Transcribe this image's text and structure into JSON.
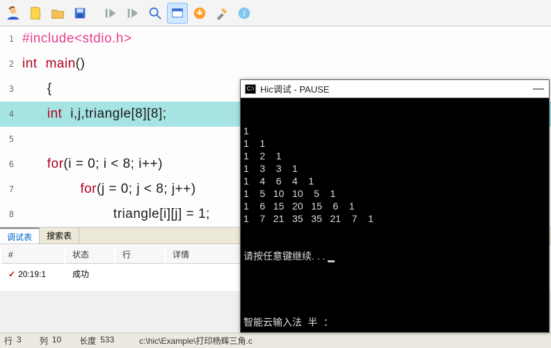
{
  "toolbar": {
    "icons": [
      "avatar",
      "note",
      "folder",
      "save",
      "sep",
      "run",
      "step",
      "search",
      "window",
      "download",
      "tools",
      "info"
    ]
  },
  "code": {
    "lines": [
      {
        "n": "1",
        "html": "<span class='k-pp'>#include&lt;stdio.h&gt;</span>"
      },
      {
        "n": "2",
        "html": "<span class='k-type'>int</span> <span class='k-type'>main</span><span class='k-id'>()</span>"
      },
      {
        "n": "3",
        "html": "   <span class='k-id'>{</span>"
      },
      {
        "n": "4",
        "html": "   <span class='k-type'>int</span> <span class='k-id'>i,j,triangle[8][8];</span>",
        "hl": true
      },
      {
        "n": "5",
        "html": ""
      },
      {
        "n": "6",
        "html": "   <span class='k-type'>for</span><span class='k-id'>(i = 0; i &lt; 8; i++)</span>"
      },
      {
        "n": "7",
        "html": "       <span class='k-type'>for</span><span class='k-id'>(j = 0; j &lt; 8; j++)</span>"
      },
      {
        "n": "8",
        "html": "           <span class='k-id'>triangle[i][j] = 1;</span>"
      }
    ]
  },
  "tabs": {
    "debug": "调试表",
    "search": "搜索表"
  },
  "debugTable": {
    "headers": {
      "idx": "#",
      "status": "状态",
      "line": "行",
      "detail": "详情"
    },
    "row": {
      "mark": "✓",
      "time": "20:19:1",
      "status": "成功",
      "line": "",
      "detail": ""
    }
  },
  "status": {
    "rowLabel": "行",
    "rowVal": "3",
    "colLabel": "列",
    "colVal": "10",
    "lenLabel": "长度",
    "lenVal": "533",
    "path": "c:\\hic\\Example\\打印杨辉三角.c"
  },
  "console": {
    "title": "Hic调试  - PAUSE",
    "iconText": "C:\\",
    "triangle": [
      [
        1
      ],
      [
        1,
        1
      ],
      [
        1,
        2,
        1
      ],
      [
        1,
        3,
        3,
        1
      ],
      [
        1,
        4,
        6,
        4,
        1
      ],
      [
        1,
        5,
        10,
        10,
        5,
        1
      ],
      [
        1,
        6,
        15,
        20,
        15,
        6,
        1
      ],
      [
        1,
        7,
        21,
        35,
        35,
        21,
        7,
        1
      ]
    ],
    "prompt": "请按任意键继续. . .",
    "ime": "智能云输入法 半 ："
  }
}
